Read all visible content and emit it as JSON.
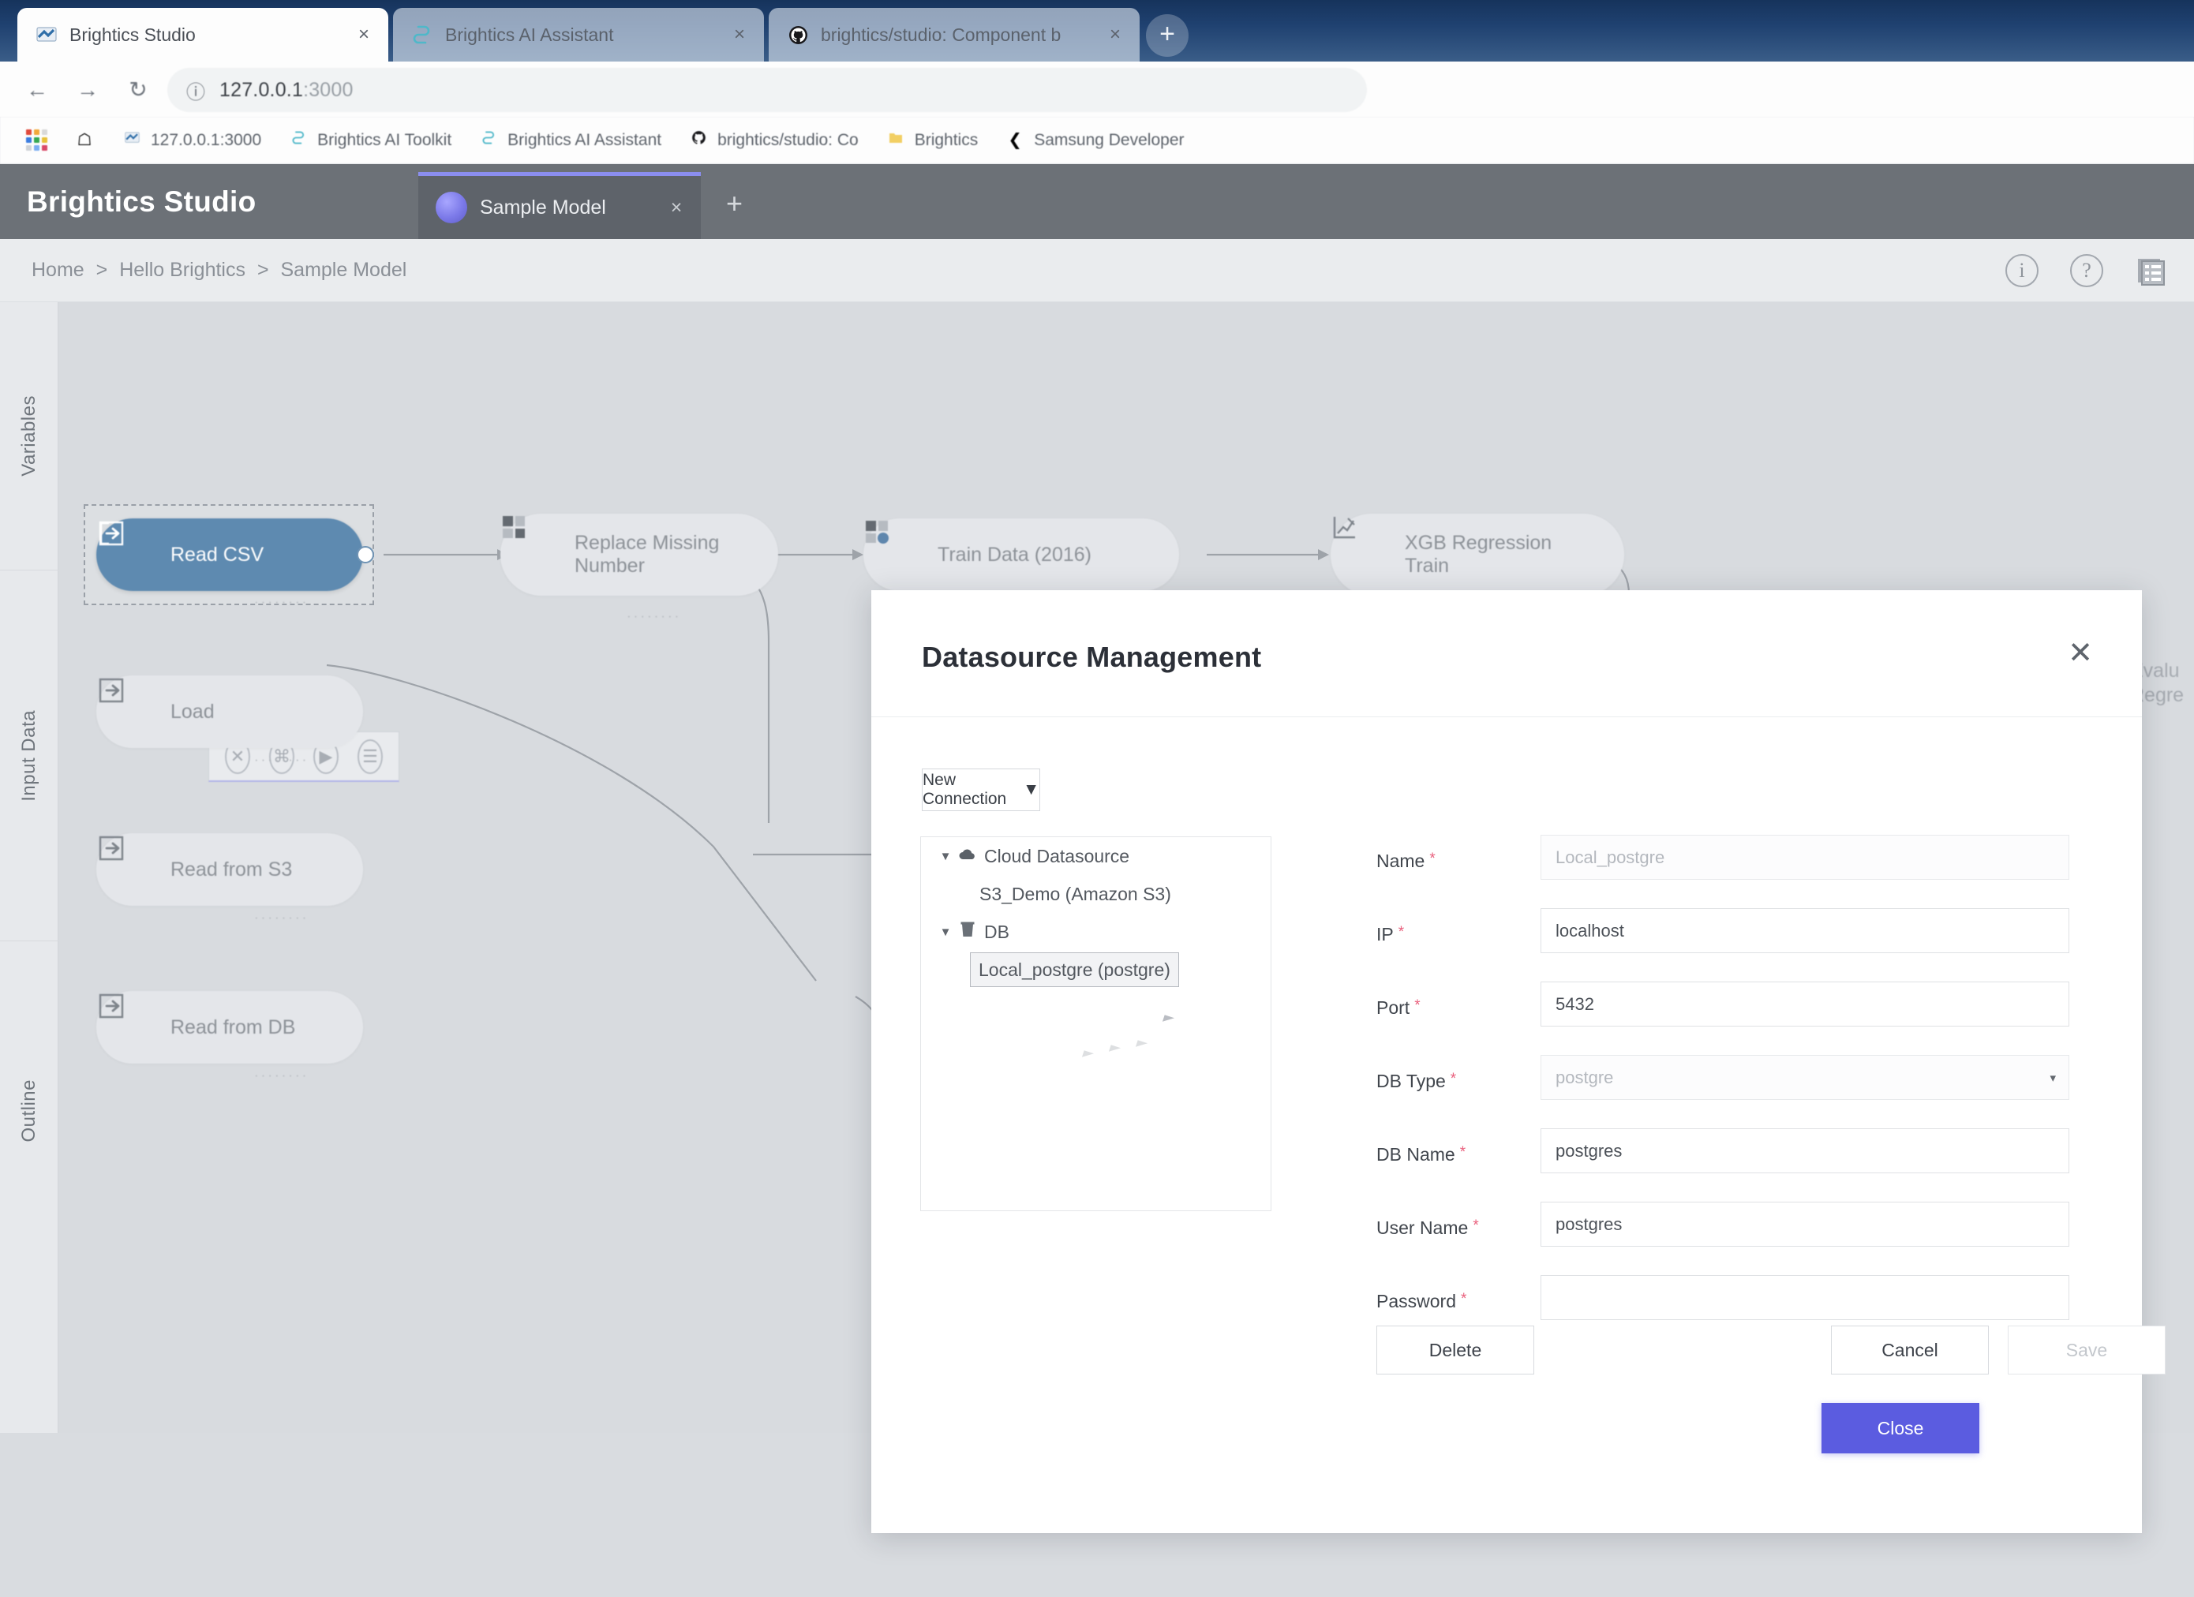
{
  "browser": {
    "tabs": [
      {
        "title": "Brightics Studio",
        "favicon": "brightics-favicon",
        "active": true
      },
      {
        "title": "Brightics AI Assistant",
        "favicon": "brightics-ai-favicon",
        "active": false
      },
      {
        "title": "brightics/studio: Component b",
        "favicon": "github-favicon",
        "active": false
      }
    ],
    "new_tab_label": "+",
    "close_label": "×",
    "nav": {
      "back": "←",
      "forward": "→",
      "reload": "↻",
      "info": "ⓘ"
    },
    "url": {
      "host": "127.0.0.1",
      "port": ":3000"
    },
    "bookmarks": [
      {
        "label": "",
        "icon": "apps-grid-icon"
      },
      {
        "label": "",
        "icon": "bookmark-page-icon"
      },
      {
        "label": "127.0.0.1:3000",
        "icon": "brightics-favicon"
      },
      {
        "label": "Brightics AI Toolkit",
        "icon": "brightics-ai-favicon"
      },
      {
        "label": "Brightics AI Assistant",
        "icon": "brightics-ai-favicon"
      },
      {
        "label": "brightics/studio: Co",
        "icon": "github-favicon"
      },
      {
        "label": "Brightics",
        "icon": "folder-icon"
      },
      {
        "label": "Samsung Developer",
        "icon": "samsung-icon"
      }
    ]
  },
  "app": {
    "logo": "Brightics Studio",
    "model_tab": {
      "label": "Sample Model",
      "close": "×"
    },
    "add_tab": "+",
    "breadcrumb": {
      "items": [
        "Home",
        "Hello Brightics",
        "Sample Model"
      ],
      "separator": ">"
    },
    "header_icons": [
      {
        "name": "info-icon",
        "glyph": "i"
      },
      {
        "name": "help-icon",
        "glyph": "?"
      },
      {
        "name": "report-icon",
        "glyph": "▤"
      }
    ]
  },
  "rail": {
    "items": [
      {
        "label": "Variables"
      },
      {
        "label": "Input Data"
      },
      {
        "label": "Outline"
      }
    ]
  },
  "canvas": {
    "nodes": [
      {
        "id": "read-csv",
        "label": "Read CSV",
        "icon": "import-icon",
        "state": "selected"
      },
      {
        "id": "load",
        "label": "Load",
        "icon": "import-icon",
        "state": "dim"
      },
      {
        "id": "read-s3",
        "label": "Read from S3",
        "icon": "import-icon",
        "state": "dim"
      },
      {
        "id": "read-db",
        "label": "Read from DB",
        "icon": "import-icon",
        "state": "dim"
      },
      {
        "id": "replace-missing",
        "label": "Replace Missing Number",
        "icon": "table-icon",
        "state": "dim"
      },
      {
        "id": "train-data",
        "label": "Train Data (2016)",
        "icon": "table-icon",
        "state": "dim"
      },
      {
        "id": "xgb-train",
        "label": "XGB Regression Train",
        "icon": "chart-icon",
        "state": "dim"
      }
    ],
    "edge_node": {
      "line1": "Evalu",
      "line2": "Regre"
    },
    "node_toolbar": [
      {
        "name": "delete-node-icon",
        "glyph": "✕"
      },
      {
        "name": "share-node-icon",
        "glyph": "⌘"
      },
      {
        "name": "run-node-icon",
        "glyph": "▶"
      },
      {
        "name": "report-node-icon",
        "glyph": "☰"
      }
    ],
    "node_dots": "········"
  },
  "dialog": {
    "title": "Datasource Management",
    "close_glyph": "✕",
    "new_connection": {
      "label": "New Connection",
      "caret": "▼"
    },
    "tree": [
      {
        "level": 0,
        "caret": "▼",
        "icon": "cloud-icon",
        "label": "Cloud Datasource",
        "selected": false
      },
      {
        "level": 1,
        "caret": "",
        "icon": "",
        "label": "S3_Demo (Amazon S3)",
        "selected": false
      },
      {
        "level": 0,
        "caret": "▼",
        "icon": "db-icon",
        "label": "DB",
        "selected": false
      },
      {
        "level": 1,
        "caret": "",
        "icon": "",
        "label": "Local_postgre (postgre)",
        "selected": true
      }
    ],
    "fields": [
      {
        "label": "Name",
        "required": true,
        "value": "Local_postgre",
        "placeholder_style": true,
        "type": "text"
      },
      {
        "label": "IP",
        "required": true,
        "value": "localhost",
        "placeholder_style": false,
        "type": "text"
      },
      {
        "label": "Port",
        "required": true,
        "value": "5432",
        "placeholder_style": false,
        "type": "text"
      },
      {
        "label": "DB Type",
        "required": true,
        "value": "postgre",
        "placeholder_style": true,
        "type": "select",
        "caret": "▾"
      },
      {
        "label": "DB Name",
        "required": true,
        "value": "postgres",
        "placeholder_style": false,
        "type": "text"
      },
      {
        "label": "User Name",
        "required": true,
        "value": "postgres",
        "placeholder_style": false,
        "type": "text"
      },
      {
        "label": "Password",
        "required": true,
        "value": "",
        "placeholder_style": false,
        "type": "password"
      }
    ],
    "buttons": {
      "delete": "Delete",
      "cancel": "Cancel",
      "save": "Save",
      "close": "Close"
    },
    "accent_color": "#5b5ce0",
    "required_color": "#e9607d"
  }
}
